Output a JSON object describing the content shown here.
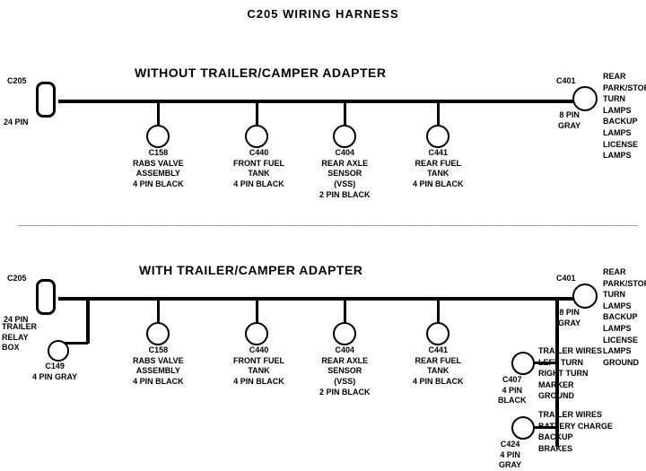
{
  "title": "C205 WIRING HARNESS",
  "section1": {
    "label": "WITHOUT  TRAILER/CAMPER  ADAPTER",
    "connectors": [
      {
        "id": "C205_top",
        "label_top": "C205",
        "label_bot": "24 PIN",
        "type": "rect"
      },
      {
        "id": "C158_top",
        "label_top": "C158",
        "label_mid": "RABS VALVE",
        "label_bot": "ASSEMBLY",
        "label_sub": "4 PIN BLACK"
      },
      {
        "id": "C440_top",
        "label_top": "C440",
        "label_mid": "FRONT FUEL",
        "label_bot": "TANK",
        "label_sub": "4 PIN BLACK"
      },
      {
        "id": "C404_top",
        "label_top": "C404",
        "label_mid": "REAR AXLE",
        "label_bot": "SENSOR",
        "label_sub2": "(VSS)",
        "label_sub": "2 PIN BLACK"
      },
      {
        "id": "C441_top",
        "label_top": "C441",
        "label_mid": "REAR FUEL",
        "label_bot": "TANK",
        "label_sub": "4 PIN BLACK"
      },
      {
        "id": "C401_top",
        "label_top": "C401",
        "label_bot": "8 PIN",
        "label_sub": "GRAY",
        "type": "circle_right"
      }
    ],
    "c401_right": "REAR PARK/STOP\nTURN LAMPS\nBACKUP LAMPS\nLICENSE LAMPS"
  },
  "section2": {
    "label": "WITH  TRAILER/CAMPER  ADAPTER",
    "connectors": [
      {
        "id": "C205_bot",
        "label_top": "C205",
        "label_bot": "24 PIN",
        "type": "rect"
      },
      {
        "id": "C158_bot",
        "label_top": "C158",
        "label_mid": "RABS VALVE",
        "label_bot": "ASSEMBLY",
        "label_sub": "4 PIN BLACK"
      },
      {
        "id": "C440_bot",
        "label_top": "C440",
        "label_mid": "FRONT FUEL",
        "label_bot": "TANK",
        "label_sub": "4 PIN BLACK"
      },
      {
        "id": "C404_bot",
        "label_top": "C404",
        "label_mid": "REAR AXLE",
        "label_bot": "SENSOR",
        "label_sub2": "(VSS)",
        "label_sub": "2 PIN BLACK"
      },
      {
        "id": "C441_bot",
        "label_top": "C441",
        "label_mid": "REAR FUEL",
        "label_bot": "TANK",
        "label_sub": "4 PIN BLACK"
      },
      {
        "id": "C401_bot",
        "label_top": "C401",
        "label_bot": "8 PIN",
        "label_sub": "GRAY",
        "type": "circle_right"
      }
    ],
    "c149": {
      "label": "C149\n4 PIN GRAY",
      "extra": "TRAILER\nRELAY\nBOX"
    },
    "c407": {
      "label": "C407\n4 PIN\nBLACK",
      "right": "TRAILER WIRES\nLEFT TURN\nRIGHT TURN\nMARKER\nGROUND"
    },
    "c424": {
      "label": "C424\n4 PIN\nGRAY",
      "right": "TRAILER WIRES\nBATTERY CHARGE\nBACKUP\nBRAKES"
    },
    "c401_right": "REAR PARK/STOP\nTURN LAMPS\nBACKUP LAMPS\nLICENSE LAMPS\nGROUND"
  }
}
